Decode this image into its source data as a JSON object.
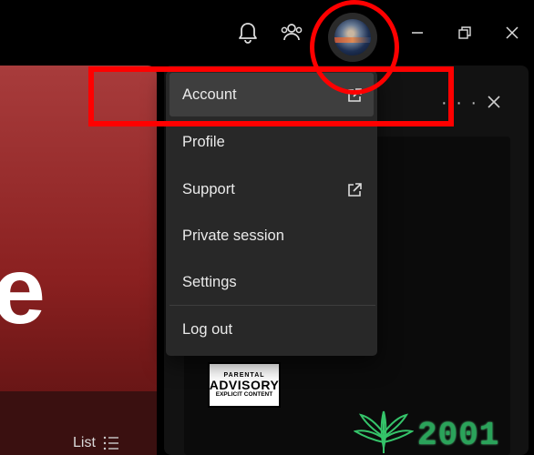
{
  "menu": {
    "items": [
      {
        "label": "Account",
        "external": true,
        "highlighted": true
      },
      {
        "label": "Profile",
        "external": false
      },
      {
        "label": "Support",
        "external": true
      },
      {
        "label": "Private session",
        "external": false
      },
      {
        "label": "Settings",
        "external": false
      },
      {
        "label": "Log out",
        "external": false
      }
    ]
  },
  "hero": {
    "letter": "e"
  },
  "library": {
    "view_label": "List"
  },
  "album": {
    "advisory_line1": "PARENTAL",
    "advisory_line2": "ADVISORY",
    "advisory_line3": "EXPLICIT CONTENT",
    "title": "2001"
  },
  "panel": {
    "more": "· · ·"
  },
  "colors": {
    "annotation": "#ff0000",
    "menu_bg": "#282828",
    "hero": "#8a2020"
  },
  "icons": [
    "bell-icon",
    "friends-icon",
    "avatar",
    "minimize-icon",
    "maximize-icon",
    "close-icon",
    "external-link-icon",
    "list-icon"
  ]
}
